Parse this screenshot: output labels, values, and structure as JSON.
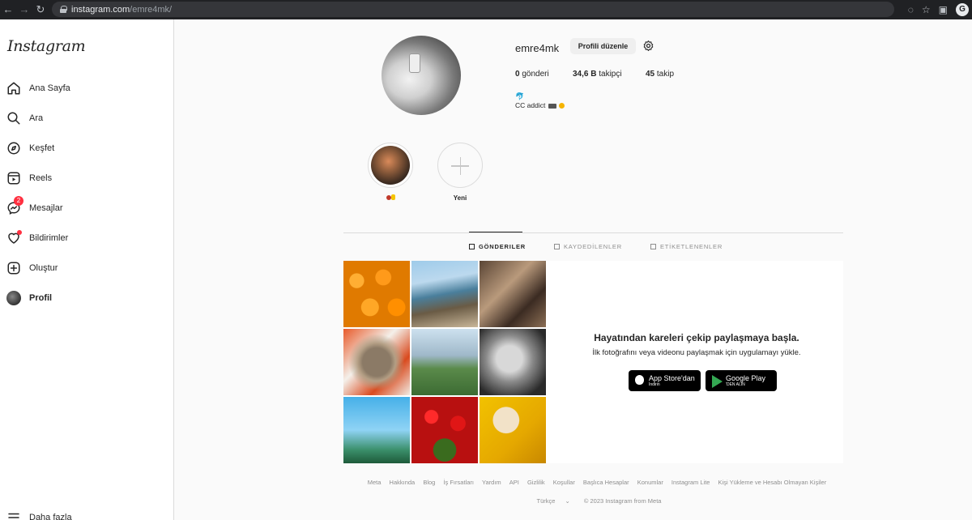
{
  "browser": {
    "url_host": "instagram.com",
    "url_path": "/emre4mk/",
    "profile_initial": "G"
  },
  "sidebar": {
    "logo": "Instagram",
    "items": [
      {
        "label": "Ana Sayfa",
        "icon": "home-icon"
      },
      {
        "label": "Ara",
        "icon": "search-icon"
      },
      {
        "label": "Keşfet",
        "icon": "compass-icon"
      },
      {
        "label": "Reels",
        "icon": "reels-icon"
      },
      {
        "label": "Mesajlar",
        "icon": "messenger-icon",
        "badge": "2"
      },
      {
        "label": "Bildirimler",
        "icon": "heart-icon"
      },
      {
        "label": "Oluştur",
        "icon": "plus-square-icon"
      },
      {
        "label": "Profil",
        "icon": "avatar"
      }
    ],
    "more_label": "Daha fazla"
  },
  "profile": {
    "username": "emre4mk",
    "edit_label": "Profili düzenle",
    "posts_count": "0",
    "posts_label": "gönderi",
    "followers_count": "34,6 B",
    "followers_label": "takipçi",
    "following_count": "45",
    "following_label": "takip",
    "bio_line1": "🐬",
    "bio_text": "CC addict"
  },
  "highlights": [
    {
      "label": ""
    },
    {
      "label": "Yeni"
    }
  ],
  "tabs": [
    {
      "label": "GÖNDERILER",
      "active": true
    },
    {
      "label": "KAYDEDİLENLER",
      "active": false
    },
    {
      "label": "ETİKETLENENLER",
      "active": false
    }
  ],
  "promo": {
    "title": "Hayatından kareleri çekip paylaşmaya başla.",
    "subtitle": "İlk fotoğrafını veya videonu paylaşmak için uygulamayı yükle.",
    "app_store_big": "App Store'dan",
    "app_store_small": "İndirin",
    "google_play_big": "Google Play",
    "google_play_small": "'DEN ALIN"
  },
  "footer": {
    "links": [
      "Meta",
      "Hakkında",
      "Blog",
      "İş Fırsatları",
      "Yardım",
      "API",
      "Gizlilik",
      "Koşullar",
      "Başlıca Hesaplar",
      "Konumlar",
      "Instagram Lite",
      "Kişi Yükleme ve Hesabı Olmayan Kişiler"
    ],
    "language": "Türkçe",
    "copyright": "© 2023 Instagram from Meta"
  },
  "colors": {
    "notification_red": "#ff3040",
    "border": "#dbdbdb",
    "text_primary": "#262626",
    "text_secondary": "#8e8e8e"
  }
}
